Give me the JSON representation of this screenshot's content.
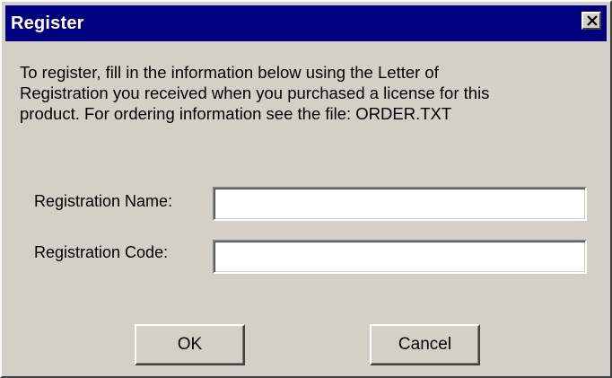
{
  "window": {
    "title": "Register",
    "close_icon": "close-icon"
  },
  "info": {
    "text_line_1": "To register, fill in the information below using the Letter of",
    "text_line_2": "Registration you received when you purchased a license for this",
    "text_line_3": "product. For ordering information see the file: ORDER.TXT"
  },
  "form": {
    "name_label": "Registration Name:",
    "name_value": "",
    "code_label": "Registration Code:",
    "code_value": ""
  },
  "buttons": {
    "ok_label": "OK",
    "cancel_label": "Cancel"
  },
  "colors": {
    "titlebar": "#000080",
    "face": "#d4d0c8"
  }
}
